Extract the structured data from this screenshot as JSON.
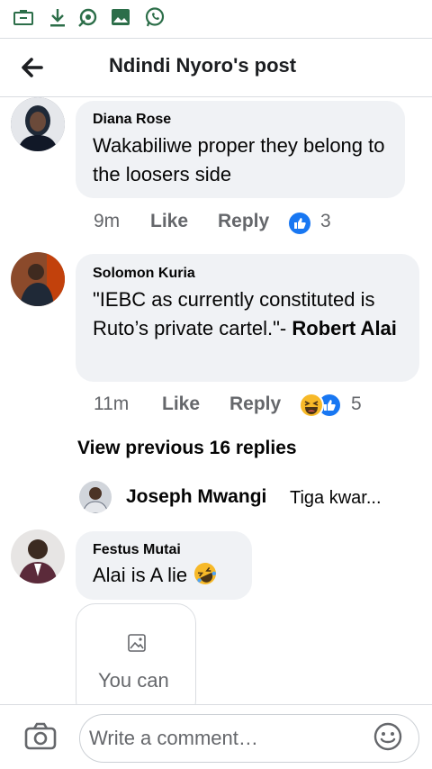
{
  "header": {
    "title": "Ndindi Nyoro's post"
  },
  "status_icons": [
    "briefcase-icon",
    "download-icon",
    "hotspot-icon",
    "gallery-icon",
    "whatsapp-icon"
  ],
  "comments": [
    {
      "author": "Diana Rose",
      "text": "Wakabiliwe proper they belong to the loosers side",
      "time": "9m",
      "like_label": "Like",
      "reply_label": "Reply",
      "reactions": [
        "like"
      ],
      "reaction_count": "3"
    },
    {
      "author": "Solomon Kuria",
      "text_main": "\"IEBC as currently constituted is Ruto’s private cartel.\"- ",
      "text_bold": "Robert Alai",
      "time": "11m",
      "like_label": "Like",
      "reply_label": "Reply",
      "reactions": [
        "haha",
        "like"
      ],
      "reaction_count": "5"
    },
    {
      "author": "Festus Mutai",
      "text": "Alai is A lie",
      "emoji": "rofl",
      "attachment_text": "You can"
    }
  ],
  "view_previous_label": "View previous 16 replies",
  "reply_preview": {
    "author": "Joseph Mwangi",
    "text": "Tiga kwar..."
  },
  "composer": {
    "placeholder": "Write a comment…"
  },
  "colors": {
    "brand_blue": "#1877f2",
    "bubble_bg": "#f0f2f5",
    "meta_gray": "#65676b",
    "haha_yellow": "#f7b928"
  }
}
